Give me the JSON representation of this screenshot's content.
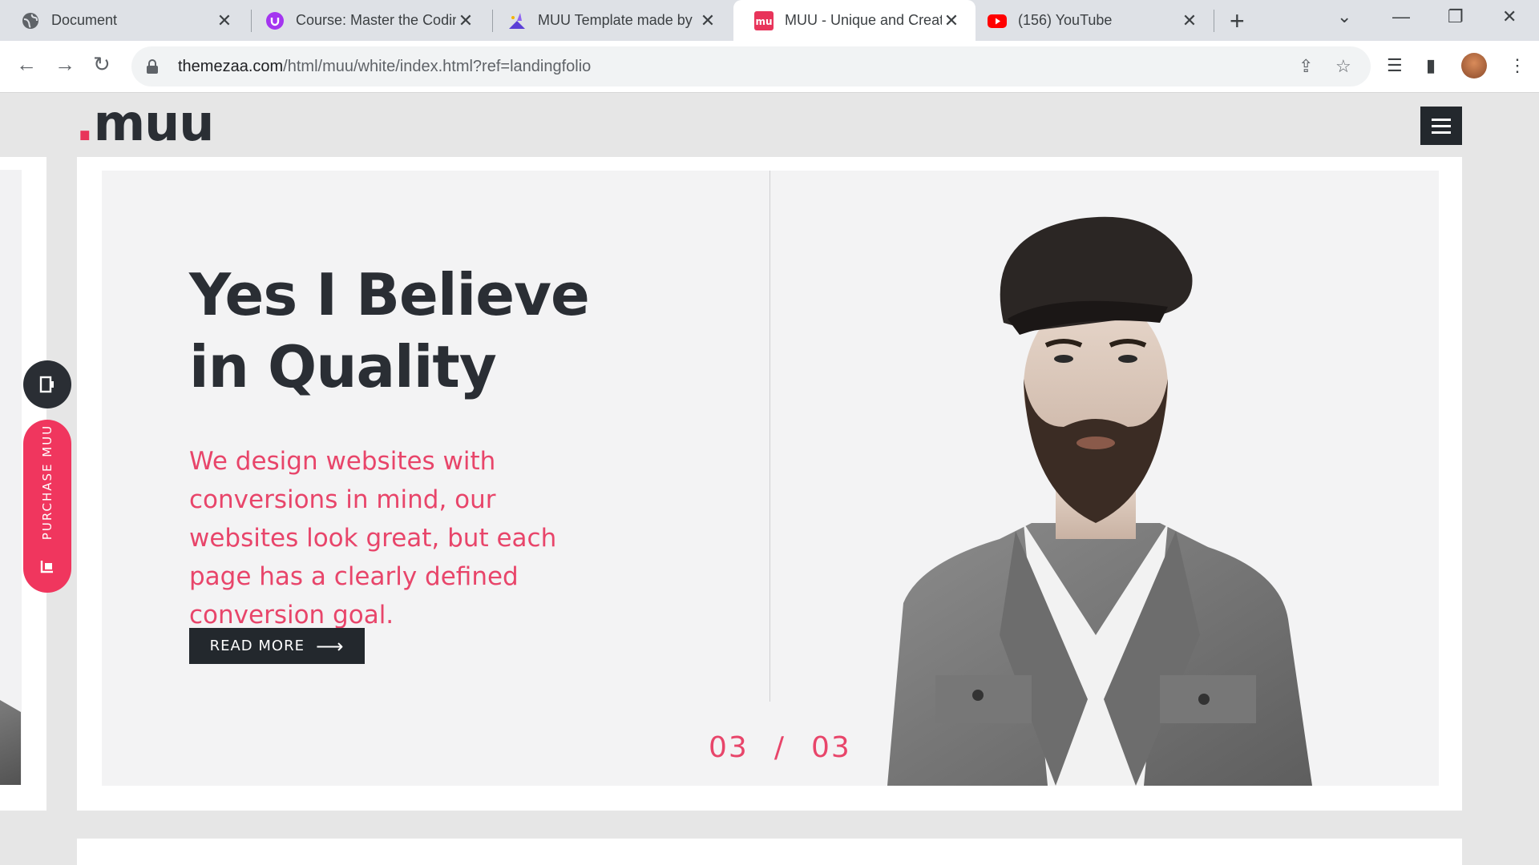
{
  "browser": {
    "tabs": [
      {
        "title": "Document",
        "active": false
      },
      {
        "title": "Course: Master the Codin",
        "active": false
      },
      {
        "title": "MUU Template made by",
        "active": false
      },
      {
        "title": "MUU - Unique and Creat",
        "active": true
      },
      {
        "title": "(156) YouTube",
        "active": false
      }
    ],
    "url_host": "themezaa.com",
    "url_path": "/html/muu/white/index.html?ref=landingfolio"
  },
  "site": {
    "logo_dot": ".",
    "logo_text": "muu",
    "accent_color": "#e8345a",
    "dark_color": "#23282d"
  },
  "hero": {
    "heading_line1": "Yes I Believe",
    "heading_line2": "in Quality",
    "description": "We design websites with conversions in mind, our websites look great, but each page has a clearly defined conversion goal.",
    "button_label": "READ MORE",
    "slide_current": "03",
    "slide_separator": "/",
    "slide_total": "03"
  },
  "sidebar": {
    "purchase_label": "PURCHASE MUU"
  },
  "icons": [
    "globe-icon",
    "udemy-icon",
    "wizard-icon",
    "muu-icon",
    "youtube-icon",
    "menu-icon",
    "door-icon",
    "cart-icon",
    "lock-icon",
    "share-icon",
    "star-icon"
  ]
}
